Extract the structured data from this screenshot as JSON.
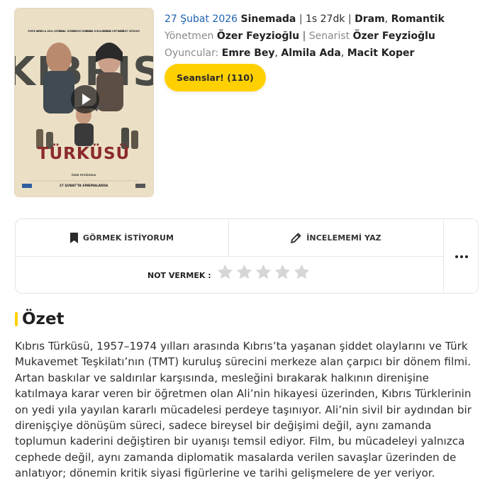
{
  "movie": {
    "poster": {
      "title_line1": "KIBRIS",
      "title_line2": "TÜRKÜSÜ",
      "release_caption": "27 ŞUBAT'TA SİNEMALARDA",
      "cast_names": [
        "EMRE BEY",
        "ALMILA ADA ÇELİKEL",
        "CEMAL HÜNAL",
        "DİDEM İNSELEL",
        "BARIŞ KIRALİOĞLU",
        "ENGİN HEPİLERİ",
        "MURAT SERDAR"
      ],
      "director_credit": "ÖZER FEYZİOĞLU"
    },
    "meta": {
      "release_date": "27 Şubat 2026",
      "status": "Sinemada",
      "duration": "1s 27dk",
      "genres": [
        "Dram",
        "Romantik"
      ]
    },
    "crew": {
      "director_label": "Yönetmen",
      "director": "Özer Feyzioğlu",
      "writer_label": "Senarist",
      "writer": "Özer Feyzioğlu"
    },
    "cast": {
      "label": "Oyuncular:",
      "names": [
        "Emre Bey",
        "Almila Ada",
        "Macit Koper"
      ]
    },
    "showtimes_button": "Seanslar! (110)"
  },
  "actions": {
    "want_to_watch": "GÖRMEK İSTİYORUM",
    "write_review": "İNCELEMEMİ YAZ",
    "rate_label": "NOT VERMEK :",
    "rating_max": 5,
    "rating_value": 0
  },
  "summary": {
    "heading": "Özet",
    "text": "Kıbrıs Türküsü, 1957–1974 yılları arasında Kıbrıs’ta yaşanan şiddet olaylarını ve Türk Mukavemet Teşkilatı’nın (TMT) kuruluş sürecini merkeze alan çarpıcı bir dönem filmi. Artan baskılar ve saldırılar karşısında, mesleğini bırakarak halkının direnişine katılmaya karar veren bir öğretmen olan Ali’nin hikayesi üzerinden, Kıbrıs Türklerinin on yedi yıla yayılan kararlı mücadelesi perdeye taşınıyor. Ali’nin sivil bir aydından bir direnişçiye dönüşüm süreci, sadece bireysel bir değişimi değil, aynı zamanda toplumun kaderini değiştiren bir uyanışı temsil ediyor. Film, bu mücadeleyi yalnızca cephede değil, aynı zamanda diplomatik masalarda verilen savaşlar üzerinden de anlatıyor; dönemin kritik siyasi figürlerine ve tarihi gelişmelere de yer veriyor."
  },
  "colors": {
    "accent": "#ffd000",
    "link_blue": "#1e62b0",
    "star_empty": "#d6d6d6"
  }
}
